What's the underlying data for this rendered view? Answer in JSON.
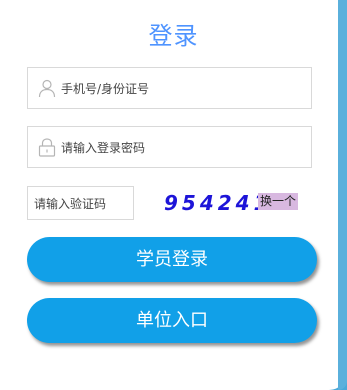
{
  "header": {
    "title": "登录"
  },
  "form": {
    "phone": {
      "placeholder": "手机号/身份证号",
      "value": "",
      "icon": "user-icon"
    },
    "password": {
      "placeholder": "请输入登录密码",
      "value": "",
      "icon": "lock-icon"
    },
    "captcha": {
      "placeholder": "请输入验证码",
      "value": "",
      "code": "954241",
      "refresh_label": "换一个"
    }
  },
  "buttons": {
    "student_login": "学员登录",
    "unit_entry": "单位入口"
  },
  "colors": {
    "accent": "#11a0e8",
    "title": "#4f94ff",
    "captcha_code": "#1d14d8",
    "refresh_bg": "#d8b8e0",
    "frame": "#4aa8d8"
  }
}
